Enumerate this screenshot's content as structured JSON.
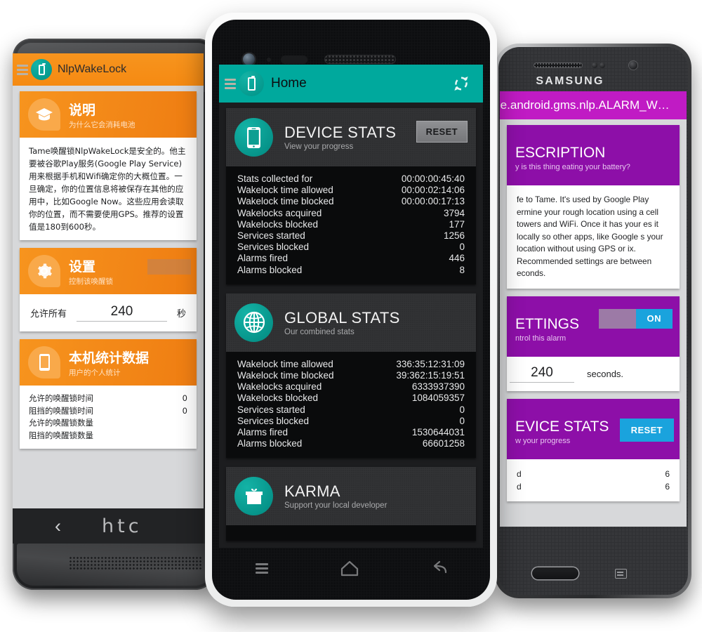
{
  "center_phone": {
    "device": "nexus",
    "appbar": {
      "title": "Home",
      "menu_icon": "hamburger-icon",
      "logo_icon": "battery-icon",
      "refresh_icon": "refresh-icon"
    },
    "accent_color": "#00a99d",
    "cards": [
      {
        "id": "device-stats",
        "icon": "smartphone-icon",
        "title": "DEVICE STATS",
        "subtitle": "View your progress",
        "action_label": "RESET",
        "rows": [
          {
            "label": "Stats collected for",
            "value": "00:00:00:45:40"
          },
          {
            "label": "Wakelock time allowed",
            "value": "00:00:02:14:06"
          },
          {
            "label": "Wakelock time blocked",
            "value": "00:00:00:17:13"
          },
          {
            "label": "Wakelocks acquired",
            "value": "3794"
          },
          {
            "label": "Wakelocks blocked",
            "value": "177"
          },
          {
            "label": "Services started",
            "value": "1256"
          },
          {
            "label": "Services blocked",
            "value": "0"
          },
          {
            "label": "Alarms fired",
            "value": "446"
          },
          {
            "label": "Alarms blocked",
            "value": "8"
          }
        ]
      },
      {
        "id": "global-stats",
        "icon": "globe-icon",
        "title": "GLOBAL STATS",
        "subtitle": "Our combined stats",
        "action_label": "",
        "rows": [
          {
            "label": "Wakelock time allowed",
            "value": "336:35:12:31:09"
          },
          {
            "label": "Wakelock time blocked",
            "value": "39:362:15:19:51"
          },
          {
            "label": "Wakelocks acquired",
            "value": "6333937390"
          },
          {
            "label": "Wakelocks blocked",
            "value": "1084059357"
          },
          {
            "label": "Services started",
            "value": "0"
          },
          {
            "label": "Services blocked",
            "value": "0"
          },
          {
            "label": "Alarms fired",
            "value": "1530644031"
          },
          {
            "label": "Alarms blocked",
            "value": "66601258"
          }
        ]
      },
      {
        "id": "karma",
        "icon": "gift-icon",
        "title": "KARMA",
        "subtitle": "Support your local developer",
        "action_label": "",
        "rows": []
      }
    ],
    "navbar": {
      "menu_icon": "menu-icon",
      "home_icon": "home-icon",
      "back_icon": "back-icon"
    }
  },
  "left_phone": {
    "device": "HTC",
    "brand_label": "htc",
    "back_label": "‹",
    "appbar": {
      "title": "NlpWakeLock",
      "logo_icon": "battery-icon",
      "menu_icon": "hamburger-icon"
    },
    "accent_color": "#f7941e",
    "cards": [
      {
        "id": "description",
        "icon": "graduation-cap-icon",
        "title": "说明",
        "subtitle": "为什么它会消耗电池",
        "body": "Tame唤醒锁NlpWakeLock是安全的。他主要被谷歌Play服务(Google Play Service)用来根据手机和Wifi确定你的大概位置。一旦确定，你的位置信息将被保存在其他的应用中，比如Google Now。这些应用会读取你的位置，而不需要使用GPS。推荐的设置值是180到600秒。"
      },
      {
        "id": "settings",
        "icon": "gear-icon",
        "title": "设置",
        "subtitle": "控制该唤醒锁",
        "toggle_state": "on",
        "field_prefix": "允许所有",
        "field_value": "240",
        "field_suffix": "秒"
      },
      {
        "id": "device-stats",
        "icon": "smartphone-icon",
        "title": "本机统计数据",
        "subtitle": "用户的个人统计",
        "rows": [
          {
            "label": "允许的唤醒锁时间",
            "value": "0"
          },
          {
            "label": "阻挡的唤醒锁时间",
            "value": "0"
          },
          {
            "label": "允许的唤醒锁数量",
            "value": ""
          },
          {
            "label": "阻挡的唤醒锁数量",
            "value": ""
          }
        ]
      }
    ]
  },
  "right_phone": {
    "device": "SAMSUNG",
    "brand_label": "SAMSUNG",
    "appbar": {
      "title": "ogle.android.gms.nlp.ALARM_W…"
    },
    "accent_color": "#8d0fa8",
    "cards": [
      {
        "id": "description",
        "title": "ESCRIPTION",
        "subtitle": "y is this thing eating your battery?",
        "body": "fe to Tame. It's used by Google Play ermine your rough location using a  cell towers and WiFi. Once it has your es it locally so other apps, like Google s your location without using GPS or ix. Recommended settings are between econds."
      },
      {
        "id": "settings",
        "title": "ETTINGS",
        "subtitle": "ntrol this alarm",
        "toggle_label": "ON",
        "field_value": "240",
        "field_unit": "seconds."
      },
      {
        "id": "device-stats",
        "title": "EVICE STATS",
        "subtitle": "w your progress",
        "action_label": "RESET",
        "rows": [
          {
            "label": "d",
            "value": "6"
          },
          {
            "label": "d",
            "value": "6"
          }
        ]
      }
    ]
  }
}
